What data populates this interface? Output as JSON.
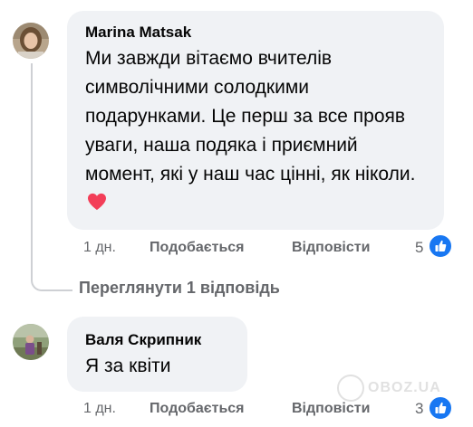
{
  "comments": [
    {
      "author": "Marina Matsak",
      "text": "Ми завжди вітаємо вчителів символічними солодкими подарунками. Це перш за все прояв уваги, наша подяка і приємний момент, які у наш час цінні, як ніколи.",
      "emoji": "❤️",
      "time": "1 дн.",
      "like_label": "Подобається",
      "reply_label": "Відповісти",
      "reaction_count": "5"
    },
    {
      "author": "Валя Скрипник",
      "text": "Я за квіти",
      "time": "1 дн.",
      "like_label": "Подобається",
      "reply_label": "Відповісти",
      "reaction_count": "3"
    }
  ],
  "view_replies_label": "Переглянути 1 відповідь",
  "watermark": "OBOZ.UA",
  "colors": {
    "bubble": "#f0f2f5",
    "meta_text": "#65676b",
    "like_blue": "#1877f2",
    "heart": "#f33e58"
  },
  "icons": {
    "reaction": "like-thumb-icon",
    "emoji": "red-heart-icon"
  }
}
